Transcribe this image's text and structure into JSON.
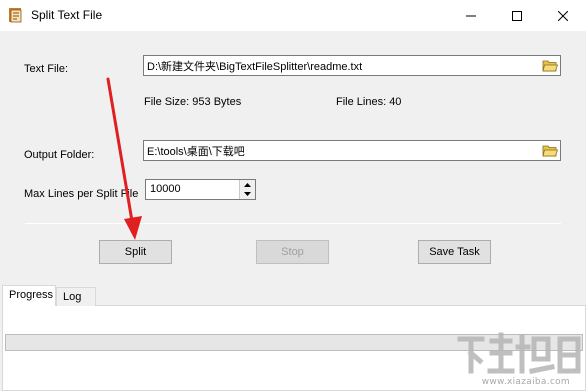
{
  "window": {
    "title": "Split Text File",
    "icon": "app-document-icon"
  },
  "text_file": {
    "label": "Text File:",
    "value": "D:\\新建文件夹\\BigTextFileSplitter\\readme.txt",
    "browse_icon": "folder-open-icon"
  },
  "file_info": {
    "size": "File Size: 953 Bytes",
    "lines": "File Lines: 40"
  },
  "output_folder": {
    "label": "Output Folder:",
    "value": "E:\\tools\\桌面\\下载吧",
    "browse_icon": "folder-open-icon"
  },
  "max_lines": {
    "label": "Max Lines per Split File",
    "value": "10000"
  },
  "buttons": {
    "split": "Split",
    "stop": "Stop",
    "save_task": "Save Task"
  },
  "tabs": [
    {
      "label": "Progress",
      "active": true
    },
    {
      "label": "Log",
      "active": false
    }
  ],
  "progress": {
    "fraction": 0
  },
  "watermark": {
    "text": "www.xiazaiba.com"
  },
  "colors": {
    "arrow": "#e02020",
    "progress": "#06b025",
    "folder": "#e8c34a"
  }
}
